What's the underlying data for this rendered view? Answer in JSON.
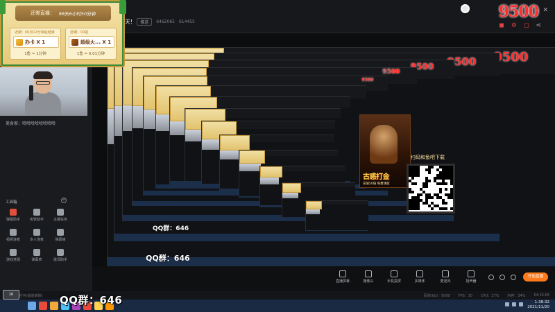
{
  "banner": {
    "head_label": "还需直播：",
    "head_value": "88天6小时50分钟",
    "card_left": {
      "header": "近期：00月12分钟后结束",
      "gift": "办卡 X 1",
      "footer": "1鱼 = 1分钟"
    },
    "card_right": {
      "header": "近期：00前",
      "gift": "超级火... X 1",
      "footer": "1鱼 = 0.01分钟"
    }
  },
  "header": {
    "title": "天!",
    "tag": "推送",
    "stat1": "6462065",
    "stat2": "614455",
    "counter": "9500"
  },
  "left_panel": {
    "caption": "美食家：哈哈哈哈哈哈哈哈",
    "tools_title": "工具箱",
    "tools": [
      {
        "label": "弹幕助手",
        "red": true
      },
      {
        "label": "房管助手",
        "red": false
      },
      {
        "label": "主播任务",
        "red": false
      },
      {
        "label": "视频连麦",
        "red": false
      },
      {
        "label": "多人连麦",
        "red": false
      },
      {
        "label": "弹幕墙",
        "red": false
      },
      {
        "label": "游戏竞猜",
        "red": false
      },
      {
        "label": "弹幕表",
        "red": false
      },
      {
        "label": "歌词助手",
        "red": false
      }
    ]
  },
  "game_ad": {
    "title": "古惑打金",
    "subtitle": "充值50倍 免费领取",
    "qr_title": "扫码和鱼吧下载"
  },
  "overlay": {
    "qq_text": "QQ群：646",
    "hd_badge": "10"
  },
  "bottom_tools": [
    "直播屏幕",
    "摄像头",
    "手机投屏",
    "多媒体",
    "麦克风",
    "扬声器"
  ],
  "live_button": "开始直播",
  "status": {
    "left": "0/6 小时任务(提前解锁)",
    "right1": "码率(kb)：5000",
    "right2": "FPS：30",
    "right3": "CPU：27%",
    "right4": "内存：34%",
    "right5": "04:15:06"
  },
  "taskbar": {
    "time": "1:38:32",
    "date": "2021/11/20"
  },
  "colors": {
    "accent_red": "#ff2d2d",
    "live_orange": "#ff7a1a",
    "banner_gold": "#e7c976"
  }
}
